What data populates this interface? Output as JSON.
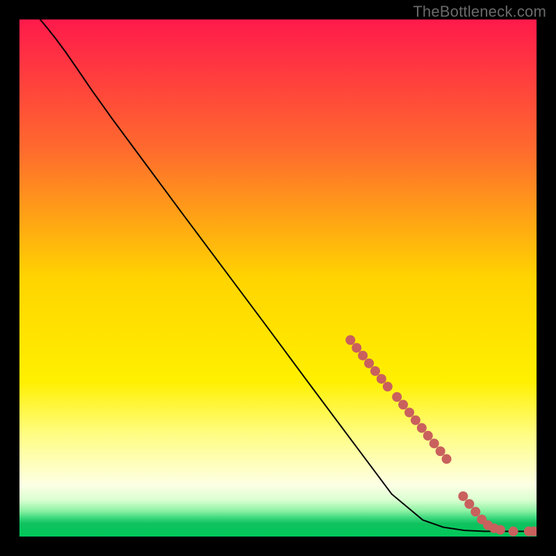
{
  "watermark": "TheBottleneck.com",
  "chart_data": {
    "type": "line",
    "title": "",
    "xlabel": "",
    "ylabel": "",
    "xlim": [
      0,
      100
    ],
    "ylim": [
      0,
      100
    ],
    "grid": false,
    "legend": false,
    "gradient_stops": [
      {
        "offset": 0.0,
        "color": "#ff1a4b"
      },
      {
        "offset": 0.25,
        "color": "#ff6a2e"
      },
      {
        "offset": 0.5,
        "color": "#ffd400"
      },
      {
        "offset": 0.7,
        "color": "#fff000"
      },
      {
        "offset": 0.8,
        "color": "#fffd80"
      },
      {
        "offset": 0.9,
        "color": "#fdffe5"
      },
      {
        "offset": 0.93,
        "color": "#d9ffd0"
      },
      {
        "offset": 0.95,
        "color": "#8ef2a4"
      },
      {
        "offset": 0.965,
        "color": "#36d67a"
      },
      {
        "offset": 0.975,
        "color": "#0fc25e"
      },
      {
        "offset": 1.0,
        "color": "#00c85a"
      }
    ],
    "series": [
      {
        "name": "curve",
        "stroke": "#000000",
        "points": [
          [
            4.0,
            100.0
          ],
          [
            5.5,
            98.2
          ],
          [
            7.0,
            96.3
          ],
          [
            9.0,
            93.6
          ],
          [
            11.0,
            90.7
          ],
          [
            14.0,
            86.3
          ],
          [
            18.0,
            80.7
          ],
          [
            24.0,
            72.6
          ],
          [
            32.0,
            61.8
          ],
          [
            40.0,
            51.1
          ],
          [
            48.0,
            40.4
          ],
          [
            56.0,
            29.6
          ],
          [
            64.0,
            18.9
          ],
          [
            72.0,
            8.2
          ],
          [
            78.0,
            3.2
          ],
          [
            82.0,
            1.8
          ],
          [
            86.0,
            1.2
          ],
          [
            90.0,
            1.0
          ],
          [
            94.0,
            1.0
          ],
          [
            98.0,
            1.0
          ]
        ]
      }
    ],
    "scatter": {
      "name": "markers",
      "color": "#c9605d",
      "radius": 7,
      "points": [
        [
          64.0,
          38.0
        ],
        [
          65.2,
          36.5
        ],
        [
          66.4,
          35.0
        ],
        [
          67.6,
          33.5
        ],
        [
          68.8,
          32.0
        ],
        [
          70.0,
          30.5
        ],
        [
          71.2,
          29.0
        ],
        [
          73.0,
          27.0
        ],
        [
          74.2,
          25.5
        ],
        [
          75.4,
          24.0
        ],
        [
          76.6,
          22.5
        ],
        [
          77.8,
          21.0
        ],
        [
          79.0,
          19.5
        ],
        [
          80.2,
          18.0
        ],
        [
          81.4,
          16.5
        ],
        [
          82.6,
          15.0
        ],
        [
          85.8,
          7.8
        ],
        [
          87.0,
          6.3
        ],
        [
          88.2,
          4.8
        ],
        [
          89.4,
          3.3
        ],
        [
          90.6,
          2.2
        ],
        [
          91.8,
          1.6
        ],
        [
          93.0,
          1.3
        ],
        [
          95.5,
          1.0
        ],
        [
          98.5,
          1.0
        ],
        [
          99.5,
          1.0
        ]
      ]
    }
  }
}
